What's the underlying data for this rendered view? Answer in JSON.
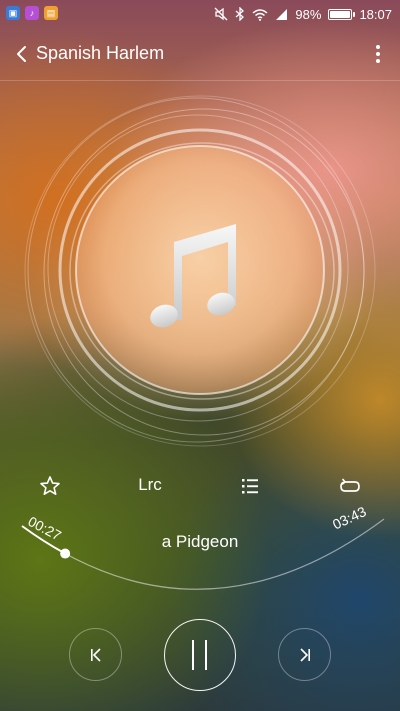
{
  "status_bar": {
    "battery_percent": "98%",
    "battery_level": 0.98,
    "time": "18:07",
    "left_icons": [
      "gallery-app-icon",
      "music-app-icon",
      "notes-app-icon"
    ],
    "right_icons": [
      "mute-vibrate-icon",
      "bluetooth-icon",
      "wifi-icon",
      "signal-icon",
      "battery-icon"
    ]
  },
  "header": {
    "title": "Spanish Harlem",
    "back_icon": "chevron-left-icon",
    "menu_icon": "more-vertical-icon"
  },
  "album_art": {
    "icon": "music-note-icon"
  },
  "controls": {
    "favorite_icon": "star-outline-icon",
    "lyrics_label": "Lrc",
    "playlist_icon": "list-icon",
    "repeat_icon": "repeat-icon"
  },
  "progress": {
    "elapsed": "00:27",
    "duration": "03:43",
    "fraction": 0.121
  },
  "lyric_line": "a Pidgeon",
  "playback": {
    "prev_icon": "skip-previous-icon",
    "pause_icon": "pause-icon",
    "next_icon": "skip-next-icon"
  },
  "colors": {
    "foreground": "#ffffff"
  }
}
